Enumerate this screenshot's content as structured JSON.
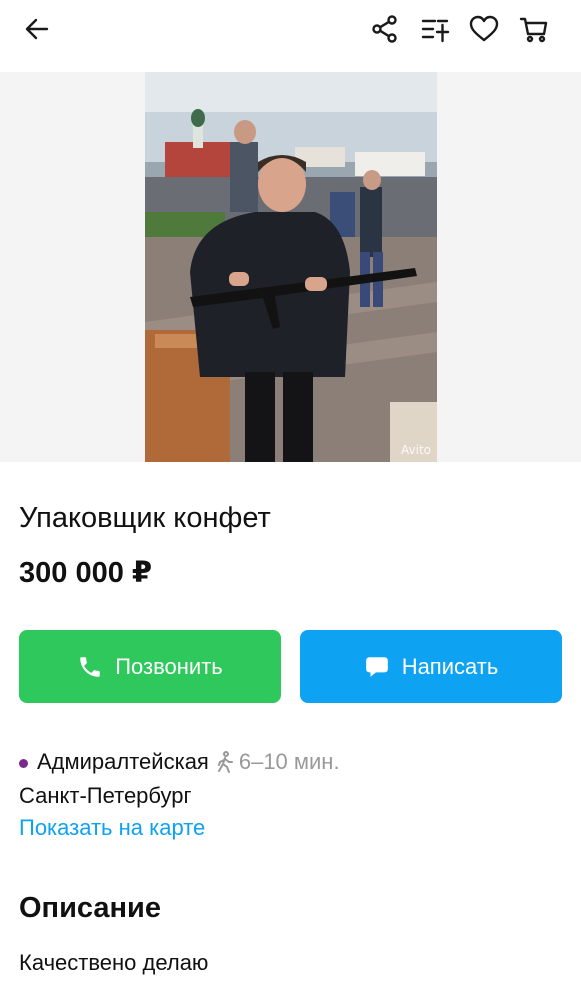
{
  "header": {
    "back_icon": "arrow-left-icon",
    "share_icon": "share-icon",
    "compare_icon": "compare-list-icon",
    "favorite_icon": "heart-icon",
    "cart_icon": "cart-icon"
  },
  "gallery": {
    "watermark": "Avito"
  },
  "listing": {
    "title": "Упаковщик конфет",
    "price": "300 000 ₽"
  },
  "actions": {
    "call_label": "Позвонить",
    "message_label": "Написать",
    "call_color": "#2fc85c",
    "message_color": "#0ea2f3"
  },
  "location": {
    "metro": "Адмиралтейская",
    "walk_time": "6–10 мин.",
    "city": "Санкт-Петербург",
    "map_link": "Показать на карте",
    "metro_color": "#7a2a8c"
  },
  "description": {
    "heading": "Описание",
    "text": "Качествено делаю"
  }
}
